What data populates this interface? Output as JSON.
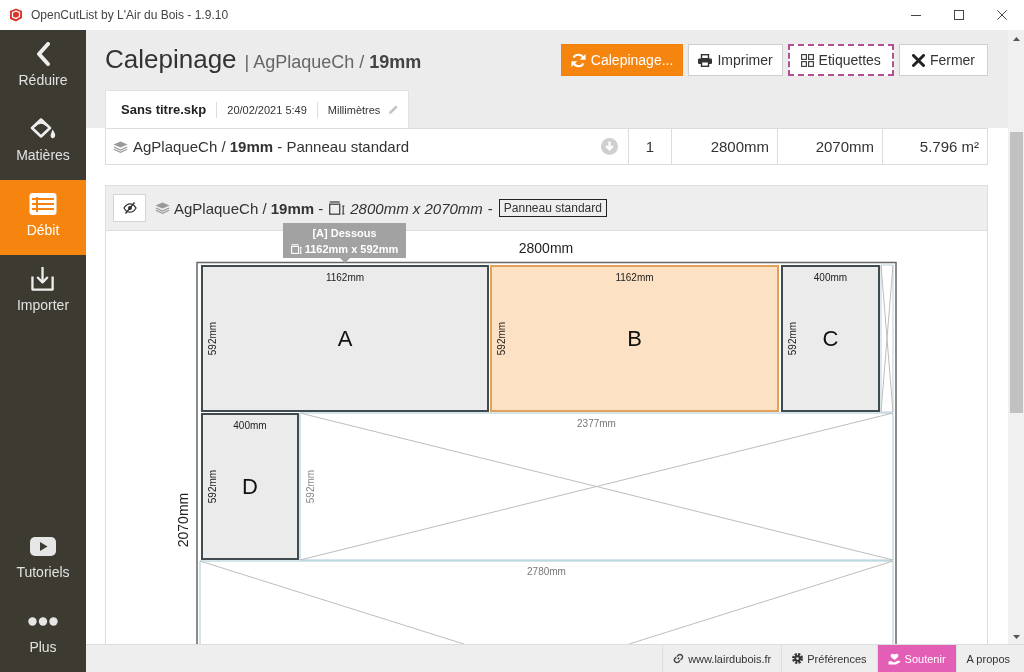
{
  "window": {
    "title": "OpenCutList by L'Air du Bois - 1.9.10"
  },
  "sidebar": {
    "items": [
      {
        "kind": "collapse",
        "label": "Réduire",
        "selected": false
      },
      {
        "kind": "materials",
        "label": "Matières",
        "selected": false
      },
      {
        "kind": "cutlist",
        "label": "Débit",
        "selected": true
      },
      {
        "kind": "import",
        "label": "Importer",
        "selected": false
      }
    ],
    "bottom_items": [
      {
        "kind": "tutorials",
        "label": "Tutoriels",
        "selected": false
      },
      {
        "kind": "more",
        "label": "Plus",
        "selected": false
      }
    ]
  },
  "header": {
    "title": "Calepinage",
    "subtitle": "| AgPlaqueCh / **19mm**",
    "buttons": [
      {
        "kind": "refresh",
        "label": "Calepinage...",
        "primary": true,
        "focused": false
      },
      {
        "kind": "print",
        "label": "Imprimer",
        "primary": false,
        "focused": false
      },
      {
        "kind": "labels",
        "label": "Etiquettes",
        "primary": false,
        "focused": true
      },
      {
        "kind": "close",
        "label": "Fermer",
        "primary": false,
        "focused": false
      }
    ]
  },
  "file_tab": {
    "filename": "Sans titre.skp",
    "date": "20/02/2021 5:49",
    "units": "Millimètres"
  },
  "material_row": {
    "name": "AgPlaqueCh / **19mm** - Panneau standard",
    "count": "1",
    "length": "2800mm",
    "width": "2070mm",
    "area": "5.796 m²"
  },
  "sheet_panel": {
    "title": "AgPlaqueCh / **19mm** -",
    "size": "2800mm x 2070mm",
    "separator": "-",
    "badge": "Panneau standard"
  },
  "diagram": {
    "width_label": "2800mm",
    "height_label": "2070mm",
    "parts": [
      {
        "letter": "A",
        "length": "1162mm",
        "width": "592mm",
        "highlighted": false
      },
      {
        "letter": "B",
        "length": "1162mm",
        "width": "592mm",
        "highlighted": true
      },
      {
        "letter": "C",
        "length": "400mm",
        "width": "592mm",
        "highlighted": false
      },
      {
        "letter": "D",
        "length": "400mm",
        "width": "592mm",
        "highlighted": false
      }
    ],
    "offcuts": [
      {
        "kind": "strip"
      },
      {
        "kind": "area",
        "length": "2377mm",
        "width": "592mm"
      },
      {
        "kind": "area",
        "length": "2780mm"
      }
    ],
    "tooltip": {
      "title": "[A] Dessous",
      "size": "1162mm x 592mm"
    }
  },
  "footer": {
    "links": [
      {
        "kind": "website",
        "label": "www.lairdubois.fr"
      },
      {
        "kind": "preferences",
        "label": "Préférences"
      },
      {
        "kind": "support",
        "label": "Soutenir"
      },
      {
        "kind": "about",
        "label": "A propos"
      }
    ]
  }
}
